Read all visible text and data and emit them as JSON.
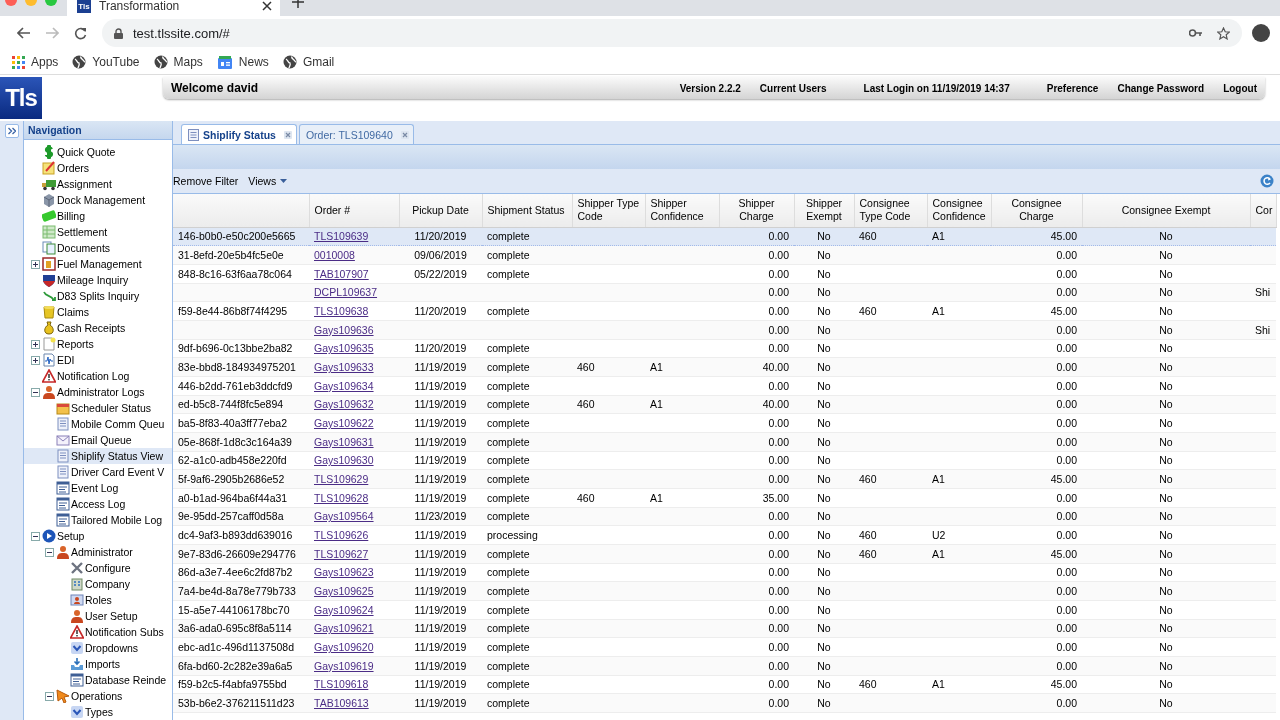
{
  "browser": {
    "tab": {
      "title": "Transformation",
      "logo": "Tls"
    },
    "address": "test.tlssite.com/#",
    "bookmarks": [
      {
        "label": "Apps",
        "kind": "apps"
      },
      {
        "label": "YouTube",
        "kind": "globe"
      },
      {
        "label": "Maps",
        "kind": "globe"
      },
      {
        "label": "News",
        "kind": "news"
      },
      {
        "label": "Gmail",
        "kind": "globe"
      }
    ]
  },
  "app_header": {
    "logo": "Tls",
    "welcome": "Welcome david",
    "items": [
      "Version 2.2.2",
      "Current Users",
      "Last Login on 11/19/2019 14:37",
      "Preference",
      "Change Password",
      "Logout"
    ]
  },
  "navigation": {
    "title": "Navigation",
    "items": [
      {
        "label": "Quick Quote",
        "kind": "coin",
        "selected": false
      },
      {
        "label": "Orders",
        "kind": "note",
        "selected": false
      },
      {
        "label": "Assignment",
        "kind": "truck",
        "selected": false
      },
      {
        "label": "Dock Management",
        "kind": "box",
        "selected": false
      },
      {
        "label": "Billing",
        "kind": "bill",
        "selected": false
      },
      {
        "label": "Settlement",
        "kind": "sheet",
        "selected": false
      },
      {
        "label": "Documents",
        "kind": "docs",
        "selected": false
      },
      {
        "label": "Fuel Management",
        "kind": "pump",
        "selected": false,
        "expanded": false
      },
      {
        "label": "Mileage Inquiry",
        "kind": "shield",
        "selected": false
      },
      {
        "label": "D83 Splits Inquiry",
        "kind": "arrows",
        "selected": false
      },
      {
        "label": "Claims",
        "kind": "bucket",
        "selected": false
      },
      {
        "label": "Cash Receipts",
        "kind": "bag",
        "selected": false
      },
      {
        "label": "Reports",
        "kind": "page",
        "selected": false,
        "expanded": false
      },
      {
        "label": "EDI",
        "kind": "wave",
        "selected": false,
        "expanded": false
      },
      {
        "label": "Notification Log",
        "kind": "warning",
        "selected": false
      },
      {
        "label": "Administrator Logs",
        "kind": "person",
        "selected": false,
        "expanded": true,
        "children": [
          {
            "label": "Scheduler Status",
            "kind": "calendar",
            "selected": false
          },
          {
            "label": "Mobile Comm Queu",
            "kind": "list",
            "selected": false
          },
          {
            "label": "Email Queue",
            "kind": "envelope",
            "selected": false
          },
          {
            "label": "Shiplify Status View",
            "kind": "list",
            "selected": true
          },
          {
            "label": "Driver Card Event V",
            "kind": "list",
            "selected": false
          },
          {
            "label": "Event Log",
            "kind": "log",
            "selected": false
          },
          {
            "label": "Access Log",
            "kind": "log",
            "selected": false
          },
          {
            "label": "Tailored Mobile Log",
            "kind": "log",
            "selected": false
          }
        ]
      },
      {
        "label": "Setup",
        "kind": "play",
        "selected": false,
        "expanded": true,
        "children": [
          {
            "label": "Administrator",
            "kind": "person",
            "selected": false,
            "expanded": true,
            "children": [
              {
                "label": "Configure",
                "kind": "tools",
                "selected": false
              },
              {
                "label": "Company",
                "kind": "building",
                "selected": false
              },
              {
                "label": "Roles",
                "kind": "card",
                "selected": false
              },
              {
                "label": "User Setup",
                "kind": "person",
                "selected": false
              },
              {
                "label": "Notification Subs",
                "kind": "warning",
                "selected": false
              },
              {
                "label": "Dropdowns",
                "kind": "chevron",
                "selected": false
              },
              {
                "label": "Imports",
                "kind": "tray",
                "selected": false
              },
              {
                "label": "Database Reinde",
                "kind": "log",
                "selected": false
              }
            ]
          },
          {
            "label": "Operations",
            "kind": "pointer",
            "selected": false,
            "expanded": true,
            "children": [
              {
                "label": "Types",
                "kind": "chevron",
                "selected": false
              }
            ]
          }
        ]
      }
    ]
  },
  "tabs": [
    {
      "label": "Shiplify Status",
      "selected": true
    },
    {
      "label": "Order: TLS109640",
      "selected": false
    }
  ],
  "toolbar": [
    {
      "label": "Remove Filter",
      "kind": "button"
    },
    {
      "label": "Views",
      "kind": "menu"
    }
  ],
  "table": {
    "columns": [
      {
        "kind": "text"
      },
      {
        "label": "Order #",
        "kind": "link"
      },
      {
        "label": "Pickup Date",
        "kind": "text"
      },
      {
        "label": "Shipment Status",
        "kind": "text"
      },
      {
        "label": "Shipper Type Code",
        "kind": "text"
      },
      {
        "label": "Shipper Confidence",
        "kind": "text"
      },
      {
        "label": "Shipper Charge",
        "kind": "text"
      },
      {
        "label": "Shipper Exempt",
        "kind": "text"
      },
      {
        "label": "Consignee Type Code",
        "kind": "text"
      },
      {
        "label": "Consignee Confidence",
        "kind": "text"
      },
      {
        "label": "Consignee Charge",
        "kind": "text"
      },
      {
        "label": "Consignee Exempt",
        "kind": "text"
      },
      {
        "label": "Cor",
        "kind": "text"
      }
    ],
    "rows": [
      {
        "selected": true,
        "cells": [
          "146-b0b0-e50c200e5665",
          "TLS109639",
          "11/20/2019",
          "complete",
          null,
          null,
          "0.00",
          "No",
          "460",
          "A1",
          "45.00",
          "No",
          null
        ]
      },
      {
        "selected": false,
        "cells": [
          "31-8efd-20e5b4fc5e0e",
          "0010008",
          "09/06/2019",
          "complete",
          null,
          null,
          "0.00",
          "No",
          null,
          null,
          "0.00",
          "No",
          null
        ]
      },
      {
        "selected": false,
        "cells": [
          "848-8c16-63f6aa78c064",
          "TAB107907",
          "05/22/2019",
          "complete",
          null,
          null,
          "0.00",
          "No",
          null,
          null,
          "0.00",
          "No",
          null
        ]
      },
      {
        "selected": false,
        "cells": [
          null,
          "DCPL109637",
          null,
          null,
          null,
          null,
          "0.00",
          "No",
          null,
          null,
          "0.00",
          "No",
          "Shi"
        ]
      },
      {
        "selected": false,
        "cells": [
          "f59-8e44-86b8f74f4295",
          "TLS109638",
          "11/20/2019",
          "complete",
          null,
          null,
          "0.00",
          "No",
          "460",
          "A1",
          "45.00",
          "No",
          null
        ]
      },
      {
        "selected": false,
        "cells": [
          null,
          "Gays109636",
          null,
          null,
          null,
          null,
          "0.00",
          "No",
          null,
          null,
          "0.00",
          "No",
          "Shi"
        ]
      },
      {
        "selected": false,
        "cells": [
          "9df-b696-0c13bbe2ba82",
          "Gays109635",
          "11/20/2019",
          "complete",
          null,
          null,
          "0.00",
          "No",
          null,
          null,
          "0.00",
          "No",
          null
        ]
      },
      {
        "selected": false,
        "cells": [
          "83e-bbd8-184934975201",
          "Gays109633",
          "11/19/2019",
          "complete",
          "460",
          "A1",
          "40.00",
          "No",
          null,
          null,
          "0.00",
          "No",
          null
        ]
      },
      {
        "selected": false,
        "cells": [
          "446-b2dd-761eb3ddcfd9",
          "Gays109634",
          "11/19/2019",
          "complete",
          null,
          null,
          "0.00",
          "No",
          null,
          null,
          "0.00",
          "No",
          null
        ]
      },
      {
        "selected": false,
        "cells": [
          "ed-b5c8-744f8fc5e894",
          "Gays109632",
          "11/19/2019",
          "complete",
          "460",
          "A1",
          "40.00",
          "No",
          null,
          null,
          "0.00",
          "No",
          null
        ]
      },
      {
        "selected": false,
        "cells": [
          "ba5-8f83-40a3ff77eba2",
          "Gays109622",
          "11/19/2019",
          "complete",
          null,
          null,
          "0.00",
          "No",
          null,
          null,
          "0.00",
          "No",
          null
        ]
      },
      {
        "selected": false,
        "cells": [
          "05e-868f-1d8c3c164a39",
          "Gays109631",
          "11/19/2019",
          "complete",
          null,
          null,
          "0.00",
          "No",
          null,
          null,
          "0.00",
          "No",
          null
        ]
      },
      {
        "selected": false,
        "cells": [
          "62-a1c0-adb458e220fd",
          "Gays109630",
          "11/19/2019",
          "complete",
          null,
          null,
          "0.00",
          "No",
          null,
          null,
          "0.00",
          "No",
          null
        ]
      },
      {
        "selected": false,
        "cells": [
          "5f-9af6-2905b2686e52",
          "TLS109629",
          "11/19/2019",
          "complete",
          null,
          null,
          "0.00",
          "No",
          "460",
          "A1",
          "45.00",
          "No",
          null
        ]
      },
      {
        "selected": false,
        "cells": [
          "a0-b1ad-964ba6f44a31",
          "TLS109628",
          "11/19/2019",
          "complete",
          "460",
          "A1",
          "35.00",
          "No",
          null,
          null,
          "0.00",
          "No",
          null
        ]
      },
      {
        "selected": false,
        "cells": [
          "9e-95dd-257caff0d58a",
          "Gays109564",
          "11/23/2019",
          "complete",
          null,
          null,
          "0.00",
          "No",
          null,
          null,
          "0.00",
          "No",
          null
        ]
      },
      {
        "selected": false,
        "cells": [
          "dc4-9af3-b893dd639016",
          "TLS109626",
          "11/19/2019",
          "processing",
          null,
          null,
          "0.00",
          "No",
          "460",
          "U2",
          "0.00",
          "No",
          null
        ]
      },
      {
        "selected": false,
        "cells": [
          "9e7-83d6-26609e294776",
          "TLS109627",
          "11/19/2019",
          "complete",
          null,
          null,
          "0.00",
          "No",
          "460",
          "A1",
          "45.00",
          "No",
          null
        ]
      },
      {
        "selected": false,
        "cells": [
          "86d-a3e7-4ee6c2fd87b2",
          "Gays109623",
          "11/19/2019",
          "complete",
          null,
          null,
          "0.00",
          "No",
          null,
          null,
          "0.00",
          "No",
          null
        ]
      },
      {
        "selected": false,
        "cells": [
          "7a4-be4d-8a78e779b733",
          "Gays109625",
          "11/19/2019",
          "complete",
          null,
          null,
          "0.00",
          "No",
          null,
          null,
          "0.00",
          "No",
          null
        ]
      },
      {
        "selected": false,
        "cells": [
          "15-a5e7-44106178bc70",
          "Gays109624",
          "11/19/2019",
          "complete",
          null,
          null,
          "0.00",
          "No",
          null,
          null,
          "0.00",
          "No",
          null
        ]
      },
      {
        "selected": false,
        "cells": [
          "3a6-ada0-695c8f8a5114",
          "Gays109621",
          "11/19/2019",
          "complete",
          null,
          null,
          "0.00",
          "No",
          null,
          null,
          "0.00",
          "No",
          null
        ]
      },
      {
        "selected": false,
        "cells": [
          "ebc-ad1c-496d1137508d",
          "Gays109620",
          "11/19/2019",
          "complete",
          null,
          null,
          "0.00",
          "No",
          null,
          null,
          "0.00",
          "No",
          null
        ]
      },
      {
        "selected": false,
        "cells": [
          "6fa-bd60-2c282e39a6a5",
          "Gays109619",
          "11/19/2019",
          "complete",
          null,
          null,
          "0.00",
          "No",
          null,
          null,
          "0.00",
          "No",
          null
        ]
      },
      {
        "selected": false,
        "cells": [
          "f59-b2c5-f4abfa9755bd",
          "TLS109618",
          "11/19/2019",
          "complete",
          null,
          null,
          "0.00",
          "No",
          "460",
          "A1",
          "45.00",
          "No",
          null
        ]
      },
      {
        "selected": false,
        "cells": [
          "53b-b6e2-376211511d23",
          "TAB109613",
          "11/19/2019",
          "complete",
          null,
          null,
          "0.00",
          "No",
          null,
          null,
          "0.00",
          "No",
          null
        ]
      }
    ]
  }
}
